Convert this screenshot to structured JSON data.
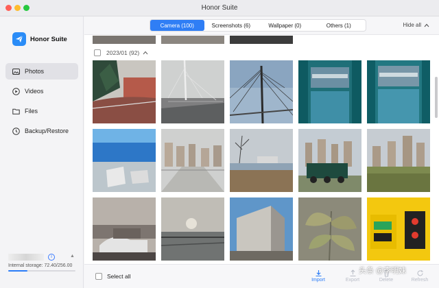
{
  "window": {
    "title": "Honor Suite"
  },
  "brand": {
    "name": "Honor Suite"
  },
  "sidebar": {
    "items": [
      {
        "label": "Photos",
        "icon": "image-icon",
        "active": true
      },
      {
        "label": "Videos",
        "icon": "play-icon",
        "active": false
      },
      {
        "label": "Files",
        "icon": "folder-icon",
        "active": false
      },
      {
        "label": "Backup/Restore",
        "icon": "backup-icon",
        "active": false
      }
    ],
    "storage": {
      "text": "Internal storage: 72.40/256.00",
      "used_fraction": 0.283
    }
  },
  "tabs": [
    {
      "label": "Camera (100)",
      "active": true
    },
    {
      "label": "Screenshots (6)",
      "active": false
    },
    {
      "label": "Wallpaper (0)",
      "active": false
    },
    {
      "label": "Others (1)",
      "active": false
    }
  ],
  "toolbar": {
    "hide_all": "Hide all"
  },
  "gallery": {
    "group_title": "2023/01 (92)"
  },
  "footer": {
    "select_all": "Select all",
    "actions": [
      {
        "label": "Import",
        "icon": "import-icon",
        "enabled": true
      },
      {
        "label": "Export",
        "icon": "export-icon",
        "enabled": false
      },
      {
        "label": "Delete",
        "icon": "delete-icon",
        "enabled": false
      },
      {
        "label": "Refresh",
        "icon": "refresh-icon",
        "enabled": false
      }
    ]
  },
  "watermark": "头条 @李明妹",
  "colors": {
    "accent": "#2f7ef5",
    "brand": "#2a8cf7"
  }
}
